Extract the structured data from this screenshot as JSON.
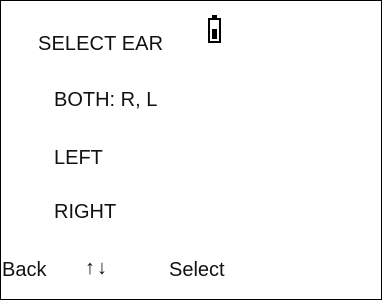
{
  "screen": {
    "title": "SELECT EAR",
    "battery": {
      "icon": "battery-icon",
      "level_fraction": 0.5
    },
    "menu_items": [
      {
        "label": "BOTH: R, L"
      },
      {
        "label": "LEFT"
      },
      {
        "label": "RIGHT"
      }
    ],
    "footer": {
      "back_label": "Back",
      "arrows_label": "↑↓",
      "select_label": "Select"
    }
  }
}
